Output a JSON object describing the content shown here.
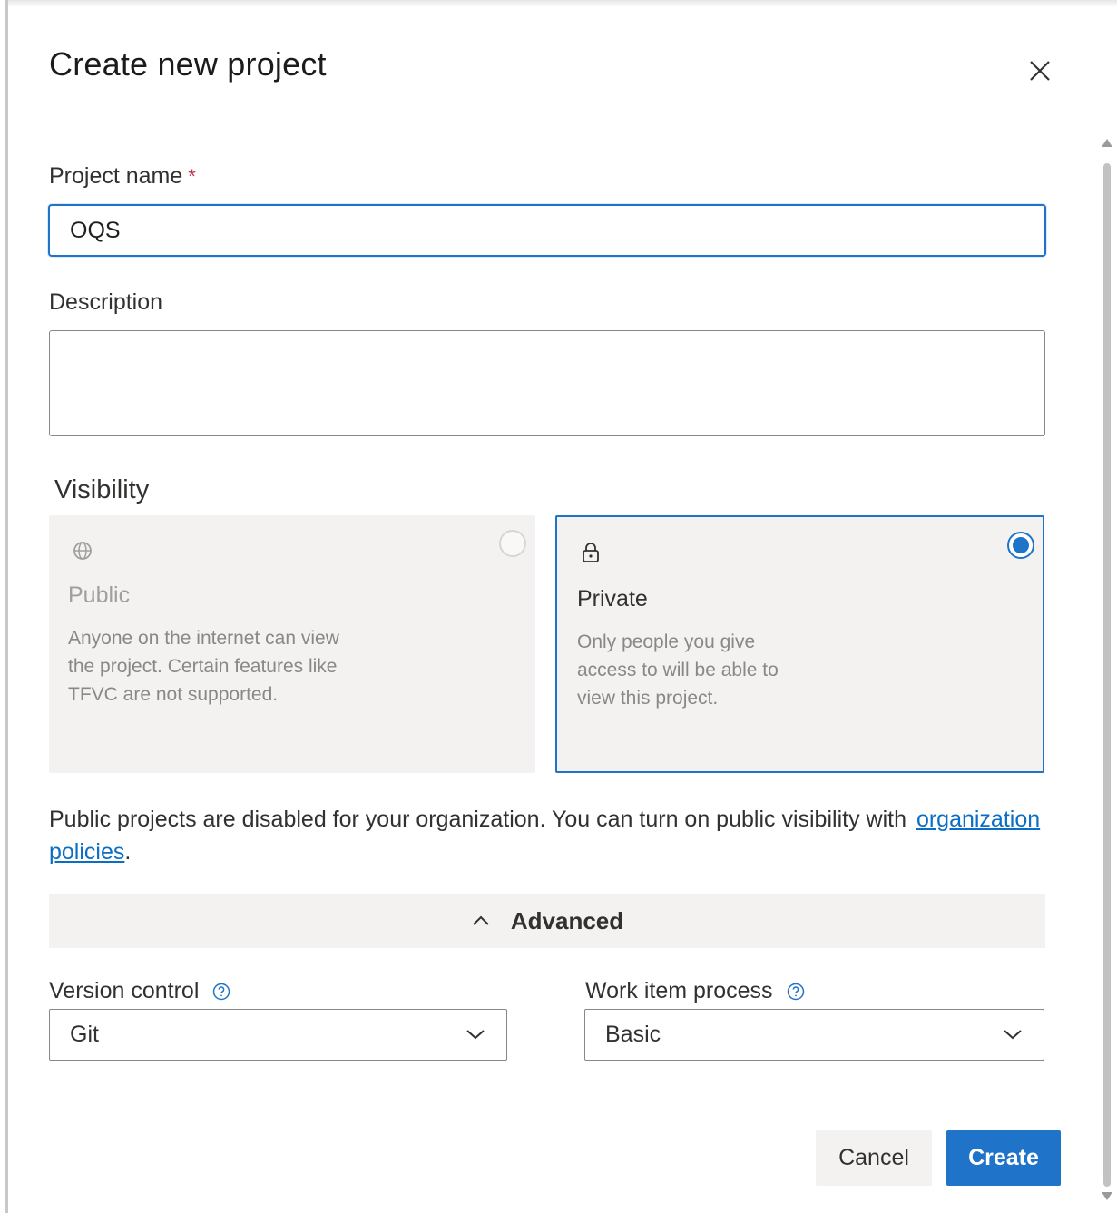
{
  "dialog": {
    "title": "Create new project",
    "close_icon": "close-icon"
  },
  "project_name": {
    "label": "Project name",
    "required_mark": "*",
    "value": "OQS"
  },
  "description": {
    "label": "Description",
    "value": ""
  },
  "visibility": {
    "label": "Visibility",
    "options": [
      {
        "title": "Public",
        "icon": "globe-icon",
        "description": "Anyone on the internet can view the project. Certain features like TFVC are not supported.",
        "selected": false,
        "disabled": true
      },
      {
        "title": "Private",
        "icon": "lock-icon",
        "description": "Only people you give access to will be able to view this project.",
        "selected": true,
        "disabled": false
      }
    ],
    "notice": "Public projects are disabled for your organization. You can turn on public visibility with",
    "notice_link": "organization policies",
    "notice_end": "."
  },
  "advanced": {
    "label": "Advanced",
    "expanded": true
  },
  "version_control": {
    "label": "Version control",
    "value": "Git"
  },
  "work_item_process": {
    "label": "Work item process",
    "value": "Basic"
  },
  "actions": {
    "cancel_label": "Cancel",
    "create_label": "Create"
  },
  "colors": {
    "accent": "#1f73c9",
    "required": "#c4314b",
    "card_bg": "#f3f2f1",
    "link": "#0b6ec4"
  }
}
